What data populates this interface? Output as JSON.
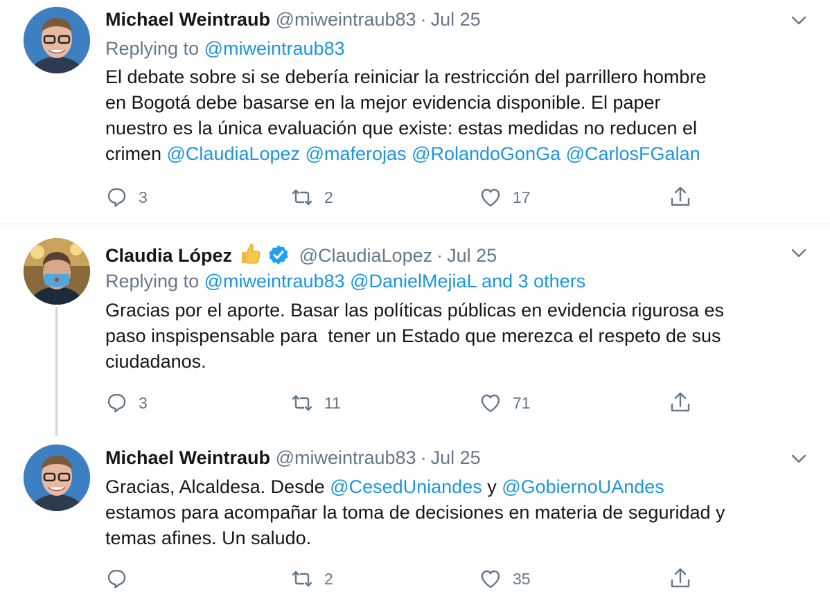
{
  "tweets": [
    {
      "name": "Michael Weintraub",
      "handle": "@miweintraub83",
      "date": "Jul 25",
      "replying_prefix": "Replying to ",
      "replying_to": "@miweintraub83",
      "text_lines": [
        "El debate sobre si se debería reiniciar la restricción del parrillero hombre",
        "en Bogotá debe basarse en la mejor evidencia disponible. El paper",
        "nuestro es la única evaluación que existe: estas medidas no reducen el"
      ],
      "last_line_prefix": "crimen ",
      "mentions": [
        "@ClaudiaLopez",
        "@maferojas",
        "@RolandoGonGa",
        "@CarlosFGalan"
      ],
      "replies": "3",
      "retweets": "2",
      "likes": "17"
    },
    {
      "name": "Claudia López",
      "handle": "@ClaudiaLopez",
      "date": "Jul 25",
      "replying_prefix": "Replying to ",
      "replying_to": "@miweintraub83 @DanielMejiaL and 3 others",
      "text_lines": [
        "Gracias por el aporte. Basar las políticas públicas en evidencia rigurosa es",
        "paso inspispensable para  tener un Estado que merezca el respeto de sus",
        "ciudadanos."
      ],
      "replies": "3",
      "retweets": "11",
      "likes": "71"
    },
    {
      "name": "Michael Weintraub",
      "handle": "@miweintraub83",
      "date": "Jul 25",
      "line1_prefix": "Gracias, Alcaldesa. Desde ",
      "mention1": "@CesedUniandes",
      "line1_mid": " y ",
      "mention2": "@GobiernoUAndes",
      "text_lines": [
        "estamos para acompañar la toma de decisiones en materia de seguridad y",
        "temas afines. Un saludo."
      ],
      "replies": "",
      "retweets": "2",
      "likes": "35"
    }
  ],
  "colors": {
    "link": "#1b95e0",
    "muted": "#657786",
    "verified": "#1da1f2"
  },
  "icons": [
    "reply-icon",
    "retweet-icon",
    "like-icon",
    "share-icon",
    "chevron-down-icon",
    "verified-icon",
    "thumbs-up-icon"
  ]
}
